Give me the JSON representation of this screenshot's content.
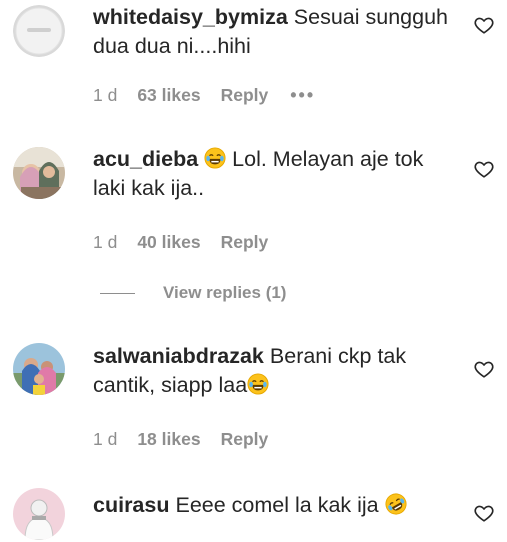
{
  "comments": [
    {
      "username": "whitedaisy_bymiza",
      "text": "Sesuai sungguh dua dua ni....hihi",
      "time": "1 d",
      "likes": "63 likes",
      "reply": "Reply",
      "more": "•••"
    },
    {
      "username": "acu_dieba",
      "text": "Lol. Melayan aje tok laki kak ija..",
      "time": "1 d",
      "likes": "40 likes",
      "reply": "Reply"
    },
    {
      "username": "salwaniabdrazak",
      "text": "Berani ckp tak cantik, siapp laa",
      "time": "1 d",
      "likes": "18 likes",
      "reply": "Reply"
    },
    {
      "username": "cuirasu",
      "text": "Eeee comel la kak ija"
    }
  ],
  "view_replies": "View replies (1)",
  "icons": {
    "heart": "heart-outline-icon",
    "emoji_laugh": "face-with-tears-of-joy-emoji",
    "emoji_rofl": "rolling-on-the-floor-laughing-emoji"
  },
  "colors": {
    "text": "#262626",
    "muted": "#8e8e8e"
  }
}
